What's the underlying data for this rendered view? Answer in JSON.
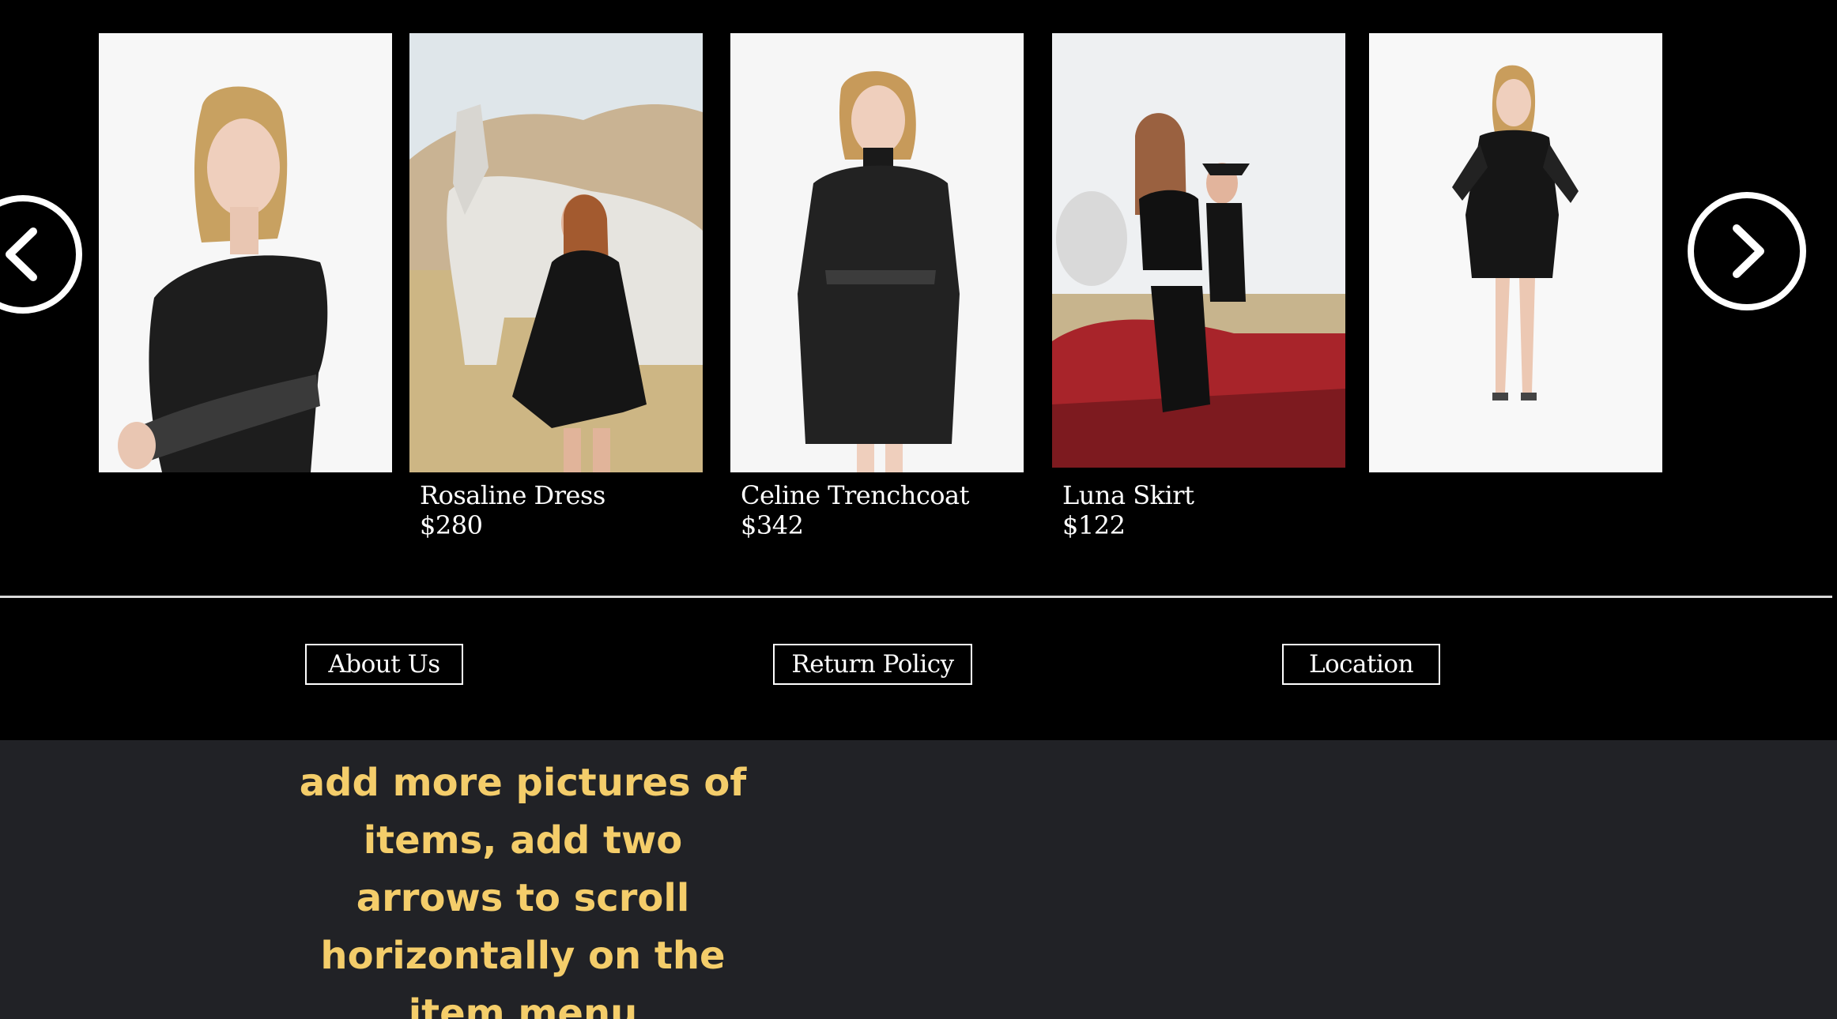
{
  "carousel": {
    "prev_icon": "chevron-left-icon",
    "next_icon": "chevron-right-icon",
    "items": [
      {
        "name": "",
        "price": ""
      },
      {
        "name": "Rosaline Dress",
        "price": "$280"
      },
      {
        "name": "Celine Trenchcoat",
        "price": "$342"
      },
      {
        "name": "Luna Skirt",
        "price": "$122"
      },
      {
        "name": "",
        "price": ""
      }
    ]
  },
  "footer": {
    "about": "About Us",
    "return_policy": "Return Policy",
    "location": "Location"
  },
  "note": {
    "text": "add more pictures of items, add two arrows to scroll horizontally on the item menu"
  },
  "colors": {
    "page_bg": "#000000",
    "note_bg": "#212226",
    "note_text": "#f4cd6a",
    "text": "#ffffff"
  }
}
